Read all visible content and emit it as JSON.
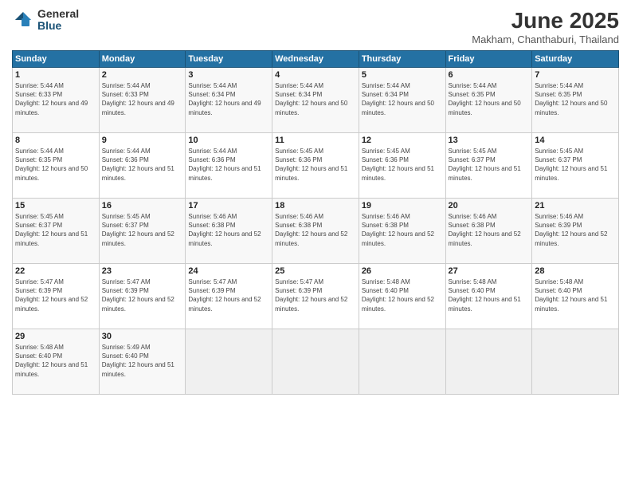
{
  "logo": {
    "general": "General",
    "blue": "Blue"
  },
  "header": {
    "month": "June 2025",
    "location": "Makham, Chanthaburi, Thailand"
  },
  "weekdays": [
    "Sunday",
    "Monday",
    "Tuesday",
    "Wednesday",
    "Thursday",
    "Friday",
    "Saturday"
  ],
  "weeks": [
    [
      {
        "day": "1",
        "sunrise": "Sunrise: 5:44 AM",
        "sunset": "Sunset: 6:33 PM",
        "daylight": "Daylight: 12 hours and 49 minutes."
      },
      {
        "day": "2",
        "sunrise": "Sunrise: 5:44 AM",
        "sunset": "Sunset: 6:33 PM",
        "daylight": "Daylight: 12 hours and 49 minutes."
      },
      {
        "day": "3",
        "sunrise": "Sunrise: 5:44 AM",
        "sunset": "Sunset: 6:34 PM",
        "daylight": "Daylight: 12 hours and 49 minutes."
      },
      {
        "day": "4",
        "sunrise": "Sunrise: 5:44 AM",
        "sunset": "Sunset: 6:34 PM",
        "daylight": "Daylight: 12 hours and 50 minutes."
      },
      {
        "day": "5",
        "sunrise": "Sunrise: 5:44 AM",
        "sunset": "Sunset: 6:34 PM",
        "daylight": "Daylight: 12 hours and 50 minutes."
      },
      {
        "day": "6",
        "sunrise": "Sunrise: 5:44 AM",
        "sunset": "Sunset: 6:35 PM",
        "daylight": "Daylight: 12 hours and 50 minutes."
      },
      {
        "day": "7",
        "sunrise": "Sunrise: 5:44 AM",
        "sunset": "Sunset: 6:35 PM",
        "daylight": "Daylight: 12 hours and 50 minutes."
      }
    ],
    [
      {
        "day": "8",
        "sunrise": "Sunrise: 5:44 AM",
        "sunset": "Sunset: 6:35 PM",
        "daylight": "Daylight: 12 hours and 50 minutes."
      },
      {
        "day": "9",
        "sunrise": "Sunrise: 5:44 AM",
        "sunset": "Sunset: 6:36 PM",
        "daylight": "Daylight: 12 hours and 51 minutes."
      },
      {
        "day": "10",
        "sunrise": "Sunrise: 5:44 AM",
        "sunset": "Sunset: 6:36 PM",
        "daylight": "Daylight: 12 hours and 51 minutes."
      },
      {
        "day": "11",
        "sunrise": "Sunrise: 5:45 AM",
        "sunset": "Sunset: 6:36 PM",
        "daylight": "Daylight: 12 hours and 51 minutes."
      },
      {
        "day": "12",
        "sunrise": "Sunrise: 5:45 AM",
        "sunset": "Sunset: 6:36 PM",
        "daylight": "Daylight: 12 hours and 51 minutes."
      },
      {
        "day": "13",
        "sunrise": "Sunrise: 5:45 AM",
        "sunset": "Sunset: 6:37 PM",
        "daylight": "Daylight: 12 hours and 51 minutes."
      },
      {
        "day": "14",
        "sunrise": "Sunrise: 5:45 AM",
        "sunset": "Sunset: 6:37 PM",
        "daylight": "Daylight: 12 hours and 51 minutes."
      }
    ],
    [
      {
        "day": "15",
        "sunrise": "Sunrise: 5:45 AM",
        "sunset": "Sunset: 6:37 PM",
        "daylight": "Daylight: 12 hours and 51 minutes."
      },
      {
        "day": "16",
        "sunrise": "Sunrise: 5:45 AM",
        "sunset": "Sunset: 6:37 PM",
        "daylight": "Daylight: 12 hours and 52 minutes."
      },
      {
        "day": "17",
        "sunrise": "Sunrise: 5:46 AM",
        "sunset": "Sunset: 6:38 PM",
        "daylight": "Daylight: 12 hours and 52 minutes."
      },
      {
        "day": "18",
        "sunrise": "Sunrise: 5:46 AM",
        "sunset": "Sunset: 6:38 PM",
        "daylight": "Daylight: 12 hours and 52 minutes."
      },
      {
        "day": "19",
        "sunrise": "Sunrise: 5:46 AM",
        "sunset": "Sunset: 6:38 PM",
        "daylight": "Daylight: 12 hours and 52 minutes."
      },
      {
        "day": "20",
        "sunrise": "Sunrise: 5:46 AM",
        "sunset": "Sunset: 6:38 PM",
        "daylight": "Daylight: 12 hours and 52 minutes."
      },
      {
        "day": "21",
        "sunrise": "Sunrise: 5:46 AM",
        "sunset": "Sunset: 6:39 PM",
        "daylight": "Daylight: 12 hours and 52 minutes."
      }
    ],
    [
      {
        "day": "22",
        "sunrise": "Sunrise: 5:47 AM",
        "sunset": "Sunset: 6:39 PM",
        "daylight": "Daylight: 12 hours and 52 minutes."
      },
      {
        "day": "23",
        "sunrise": "Sunrise: 5:47 AM",
        "sunset": "Sunset: 6:39 PM",
        "daylight": "Daylight: 12 hours and 52 minutes."
      },
      {
        "day": "24",
        "sunrise": "Sunrise: 5:47 AM",
        "sunset": "Sunset: 6:39 PM",
        "daylight": "Daylight: 12 hours and 52 minutes."
      },
      {
        "day": "25",
        "sunrise": "Sunrise: 5:47 AM",
        "sunset": "Sunset: 6:39 PM",
        "daylight": "Daylight: 12 hours and 52 minutes."
      },
      {
        "day": "26",
        "sunrise": "Sunrise: 5:48 AM",
        "sunset": "Sunset: 6:40 PM",
        "daylight": "Daylight: 12 hours and 52 minutes."
      },
      {
        "day": "27",
        "sunrise": "Sunrise: 5:48 AM",
        "sunset": "Sunset: 6:40 PM",
        "daylight": "Daylight: 12 hours and 51 minutes."
      },
      {
        "day": "28",
        "sunrise": "Sunrise: 5:48 AM",
        "sunset": "Sunset: 6:40 PM",
        "daylight": "Daylight: 12 hours and 51 minutes."
      }
    ],
    [
      {
        "day": "29",
        "sunrise": "Sunrise: 5:48 AM",
        "sunset": "Sunset: 6:40 PM",
        "daylight": "Daylight: 12 hours and 51 minutes."
      },
      {
        "day": "30",
        "sunrise": "Sunrise: 5:49 AM",
        "sunset": "Sunset: 6:40 PM",
        "daylight": "Daylight: 12 hours and 51 minutes."
      },
      null,
      null,
      null,
      null,
      null
    ]
  ]
}
